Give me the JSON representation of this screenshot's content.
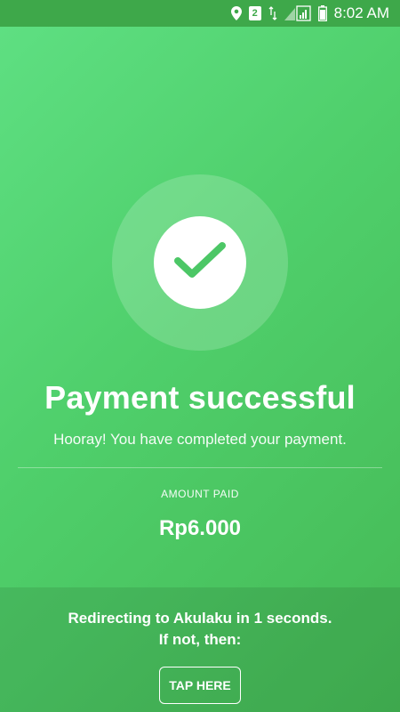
{
  "status_bar": {
    "icons": [
      "location-icon",
      "sim-2-icon",
      "data-arrows-icon",
      "signal-icon",
      "battery-icon"
    ],
    "sim_label": "2",
    "time": "8:02 AM"
  },
  "main": {
    "title": "Payment successful",
    "subtitle": "Hooray! You have completed your payment.",
    "amount_label": "AMOUNT PAID",
    "amount_value": "Rp6.000"
  },
  "footer": {
    "redirect_line1": "Redirecting to Akulaku in 1 seconds.",
    "redirect_line2": "If not, then:",
    "button_label": "TAP HERE"
  },
  "colors": {
    "background_start": "#5fe083",
    "background_end": "#45b955",
    "status_bar": "#3ea84a",
    "check": "#4cc766",
    "text": "#ffffff"
  }
}
